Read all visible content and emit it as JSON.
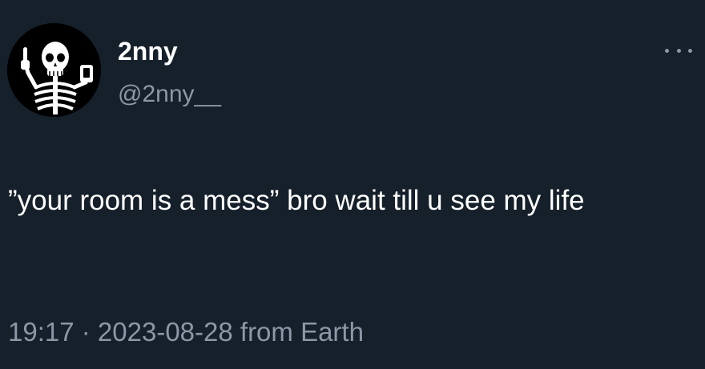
{
  "tweet": {
    "author": {
      "display_name": "2nny",
      "handle": "@2nny__",
      "avatar_icon": "skeleton-avatar-icon"
    },
    "more_icon": "more-options-icon",
    "text": "”your room is a mess” bro wait till u see my life",
    "meta": {
      "time": "19:17",
      "separator": " · ",
      "date": "2023-08-28",
      "source": " from Earth"
    }
  },
  "colors": {
    "background": "#15202b",
    "primary_text": "#ffffff",
    "secondary_text": "#8b98a5"
  }
}
